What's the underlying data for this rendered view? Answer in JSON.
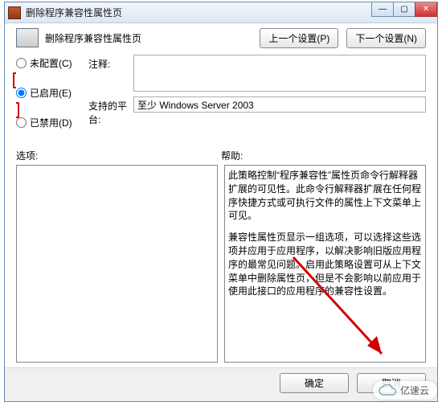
{
  "window": {
    "title": "删除程序兼容性属性页"
  },
  "header": {
    "title": "删除程序兼容性属性页"
  },
  "topButtons": {
    "prev": "上一个设置(P)",
    "next": "下一个设置(N)"
  },
  "radios": {
    "notConfigured": "未配置(C)",
    "enabled": "已启用(E)",
    "disabled": "已禁用(D)"
  },
  "form": {
    "commentLabel": "注释:",
    "commentValue": "",
    "platformLabel": "支持的平台:",
    "platformValue": "至少 Windows Server 2003"
  },
  "labels": {
    "options": "选项:",
    "help": "帮助:"
  },
  "help": {
    "p1": "此策略控制“程序兼容性”属性页命令行解释器扩展的可见性。此命令行解释器扩展在任何程序快捷方式或可执行文件的属性上下文菜单上可见。",
    "p2": "兼容性属性页显示一组选项，可以选择这些选项并应用于应用程序，以解决影响旧版应用程序的最常见问题。启用此策略设置可从上下文菜单中删除属性页，但是不会影响以前应用于使用此接口的应用程序的兼容性设置。"
  },
  "bottom": {
    "ok": "确定",
    "cancel": "取消"
  },
  "stamp": "亿速云"
}
